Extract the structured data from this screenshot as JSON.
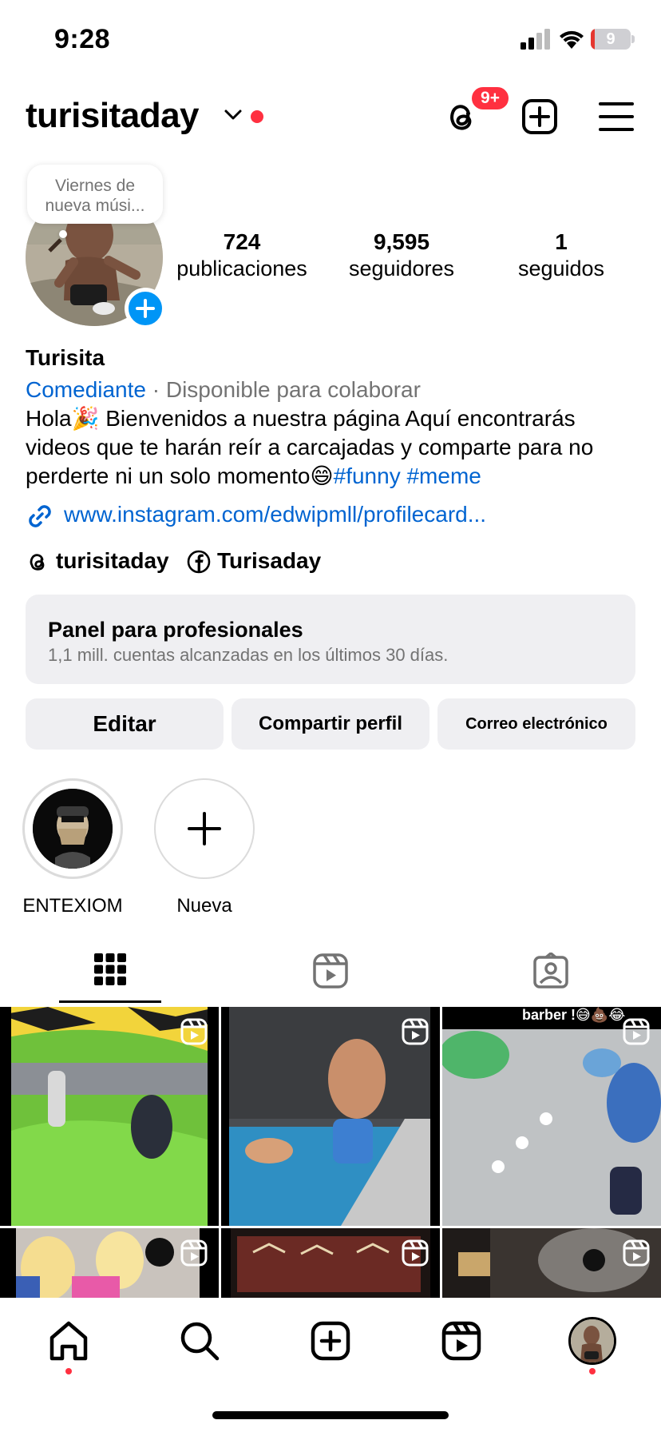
{
  "status_bar": {
    "time": "9:28",
    "battery": "9",
    "battery_level": 0.09
  },
  "header": {
    "username": "turisitaday",
    "threads_badge": "9+"
  },
  "note": {
    "line1": "Viernes de",
    "line2": "nueva músi..."
  },
  "stats": [
    {
      "value": "724",
      "label": "publicaciones"
    },
    {
      "value": "9,595",
      "label": "seguidores"
    },
    {
      "value": "1",
      "label": "seguidos"
    }
  ],
  "bio": {
    "name": "Turisita",
    "category": "Comediante",
    "availability": "· Disponible para colaborar",
    "text": "Hola🎉 Bienvenidos a nuestra página Aquí encontrarás videos que te harán reír a carcajadas y comparte para no perderte ni un solo momento😄",
    "hashtags": "#funny #meme",
    "link": "www.instagram.com/edwipmll/profilecard...",
    "threads_handle": "turisitaday",
    "facebook_name": "Turisaday"
  },
  "dashboard": {
    "title": "Panel para profesionales",
    "subtitle": "1,1 mill. cuentas alcanzadas en los últimos 30 días."
  },
  "actions": {
    "edit": "Editar",
    "share": "Compartir perfil",
    "email": "Correo electrónico"
  },
  "highlights": [
    {
      "label": "ENTEXIOM"
    },
    {
      "label": "Nueva"
    }
  ],
  "grid": {
    "caption_overlay": "barber !😅💩😂"
  },
  "colors": {
    "accent": "#0095f6",
    "link": "#0064d1",
    "badge": "#ff3040",
    "muted": "#737373",
    "button_bg": "#efeff2"
  },
  "icons": {
    "header": [
      "threads-icon",
      "create-icon",
      "menu-icon"
    ],
    "tabs": [
      "grid-icon",
      "reels-icon",
      "tagged-icon"
    ],
    "bottom_nav": [
      "home-icon",
      "search-icon",
      "create-icon",
      "reels-icon",
      "profile-avatar"
    ]
  }
}
